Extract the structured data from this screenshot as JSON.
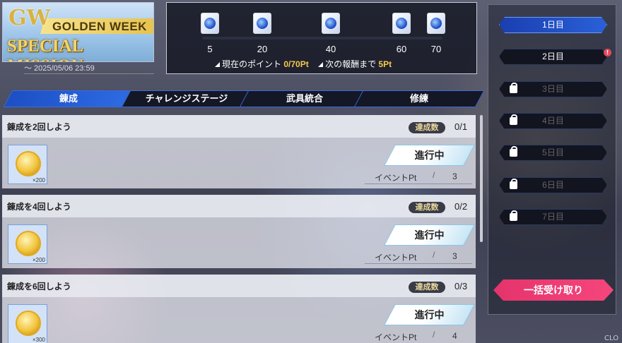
{
  "banner": {
    "logo_mark": "GW",
    "line1": "GOLDEN WEEK",
    "line2": "SPECIAL MISSION",
    "deadline": "〜 2025/05/06 23:59"
  },
  "points": {
    "milestones": [
      "5",
      "20",
      "40",
      "60",
      "70"
    ],
    "current_label": "現在のポイント",
    "current_value": "0/70Pt",
    "next_label": "次の報酬まで",
    "next_value": "5Pt"
  },
  "tabs": [
    "錬成",
    "チャレンジステージ",
    "武具統合",
    "修練"
  ],
  "missions": [
    {
      "title": "錬成を2回しよう",
      "achieve_label": "達成数",
      "count": "0/1",
      "reward_qty": "×200",
      "status": "進行中",
      "event_label": "イベントPt",
      "event_pt": "3"
    },
    {
      "title": "錬成を4回しよう",
      "achieve_label": "達成数",
      "count": "0/2",
      "reward_qty": "×200",
      "status": "進行中",
      "event_label": "イベントPt",
      "event_pt": "3"
    },
    {
      "title": "錬成を6回しよう",
      "achieve_label": "達成数",
      "count": "0/3",
      "reward_qty": "×300",
      "status": "進行中",
      "event_label": "イベントPt",
      "event_pt": "4"
    }
  ],
  "days": [
    "1日目",
    "2日目",
    "3日目",
    "4日目",
    "5日目",
    "6日目",
    "7日目"
  ],
  "day2_badge": "!",
  "claim_all": "一括受け取り",
  "corner_text": "CLO",
  "colors": {
    "accent": "#2a60d8",
    "gold": "#f6c94a",
    "claim": "#f5467c"
  }
}
